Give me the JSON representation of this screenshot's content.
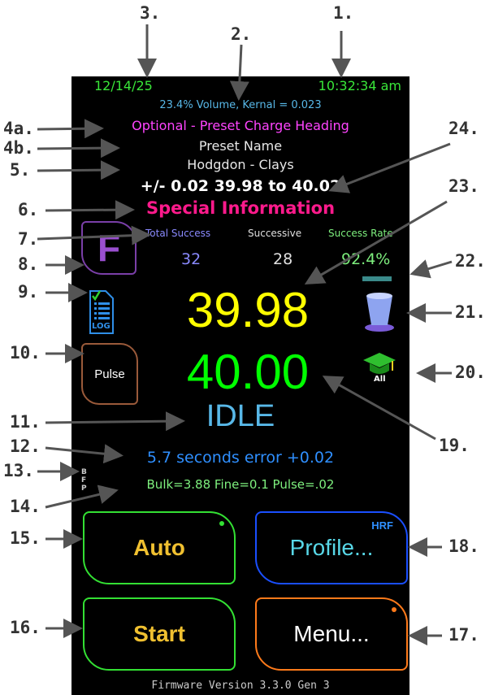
{
  "status": {
    "date": "12/14/25",
    "time": "10:32:34 am",
    "volume_line": "23.4% Volume, Kernal = 0.023"
  },
  "headings": {
    "optional": "Optional - Preset Charge Heading",
    "preset_name": "Preset Name",
    "powder": "Hodgdon - Clays",
    "tolerance": "+/- 0.02 39.98 to 40.02",
    "special": "Special Information"
  },
  "stats": {
    "total_label": "Total Success",
    "total_value": "32",
    "successive_label": "Successive",
    "successive_value": "28",
    "rate_label": "Success Rate",
    "rate_value": "92.4%"
  },
  "icons": {
    "f_letter": "F",
    "log_label": "LOG",
    "pulse_label": "Pulse",
    "all_label": "All"
  },
  "readings": {
    "target": "39.98",
    "current": "40.00",
    "state": "IDLE",
    "error_line": "5.7 seconds  error +0.02",
    "params_line": "Bulk=3.88 Fine=0.1 Pulse=.02",
    "bfp": "BFP"
  },
  "buttons": {
    "auto": "Auto",
    "profile": "Profile...",
    "profile_badge": "HRF",
    "start": "Start",
    "menu": "Menu..."
  },
  "footer": {
    "firmware": "Firmware Version 3.3.0 Gen 3"
  },
  "callouts": [
    "1.",
    "2.",
    "3.",
    "4a.",
    "4b.",
    "5.",
    "6.",
    "7.",
    "8.",
    "9.",
    "10.",
    "11.",
    "12.",
    "13.",
    "14.",
    "15.",
    "16.",
    "17.",
    "18.",
    "19.",
    "20.",
    "21.",
    "22.",
    "23.",
    "24."
  ],
  "colors": {
    "green": "#39e639",
    "cyan": "#58b8e8",
    "magenta": "#ff44ff",
    "pink": "#ff1a8c",
    "yellow": "#ffff00",
    "bright_green": "#00ff00",
    "blue": "#1a4fff",
    "orange": "#ff7a1a",
    "gold": "#f0c030"
  }
}
